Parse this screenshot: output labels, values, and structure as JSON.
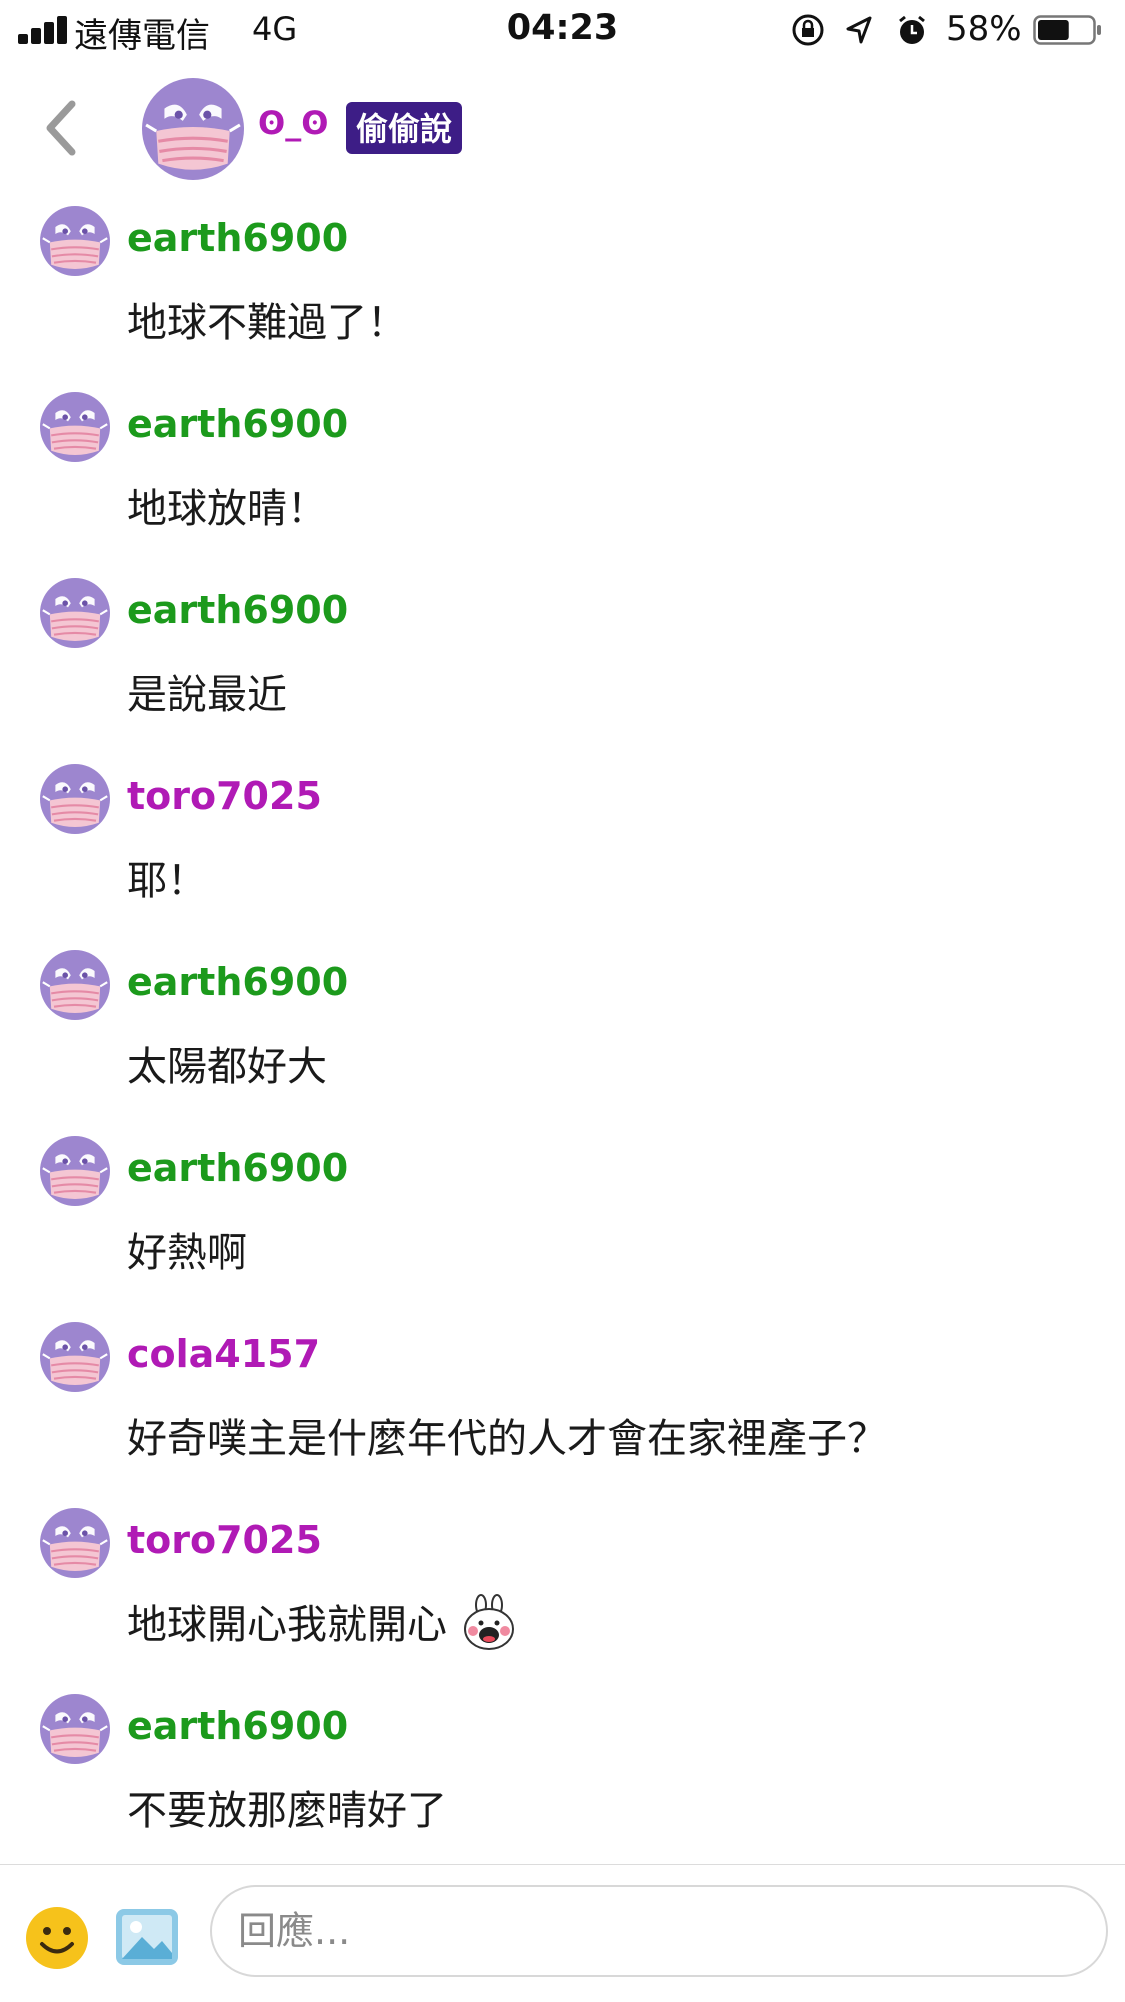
{
  "status_bar": {
    "carrier": "遠傳電信",
    "network": "4G",
    "time": "04:23",
    "battery_percent": "58%",
    "battery_level": 0.58,
    "icons": [
      "signal-icon",
      "orientation-lock-icon",
      "location-icon",
      "alarm-icon",
      "battery-icon"
    ]
  },
  "header": {
    "room_name": "ʘ_ʘ",
    "badge": "偷偷說",
    "back_icon": "chevron-left-icon"
  },
  "messages": [
    {
      "user": "earth6900",
      "text": "地球不難過了！",
      "user_color": "green"
    },
    {
      "user": "earth6900",
      "text": "地球放晴！",
      "user_color": "green"
    },
    {
      "user": "earth6900",
      "text": "是說最近",
      "user_color": "green"
    },
    {
      "user": "toro7025",
      "text": "耶！",
      "user_color": "purple"
    },
    {
      "user": "earth6900",
      "text": "太陽都好大",
      "user_color": "green"
    },
    {
      "user": "earth6900",
      "text": "好熱啊",
      "user_color": "green"
    },
    {
      "user": "cola4157",
      "text": "好奇噗主是什麼年代的人才會在家裡產子？",
      "user_color": "purple"
    },
    {
      "user": "toro7025",
      "text": "地球開心我就開心",
      "user_color": "purple",
      "sticker": "rabbit-sticker-icon"
    },
    {
      "user": "earth6900",
      "text": "不要放那麼晴好了",
      "user_color": "green"
    }
  ],
  "input": {
    "placeholder": "回應...",
    "value": ""
  },
  "colors": {
    "green_user": "#1c9a1c",
    "purple_user": "#b01ab5",
    "badge_bg": "#3d1d86",
    "avatar_purple": "#9d86cf",
    "avatar_pink": "#f4c6d3"
  }
}
